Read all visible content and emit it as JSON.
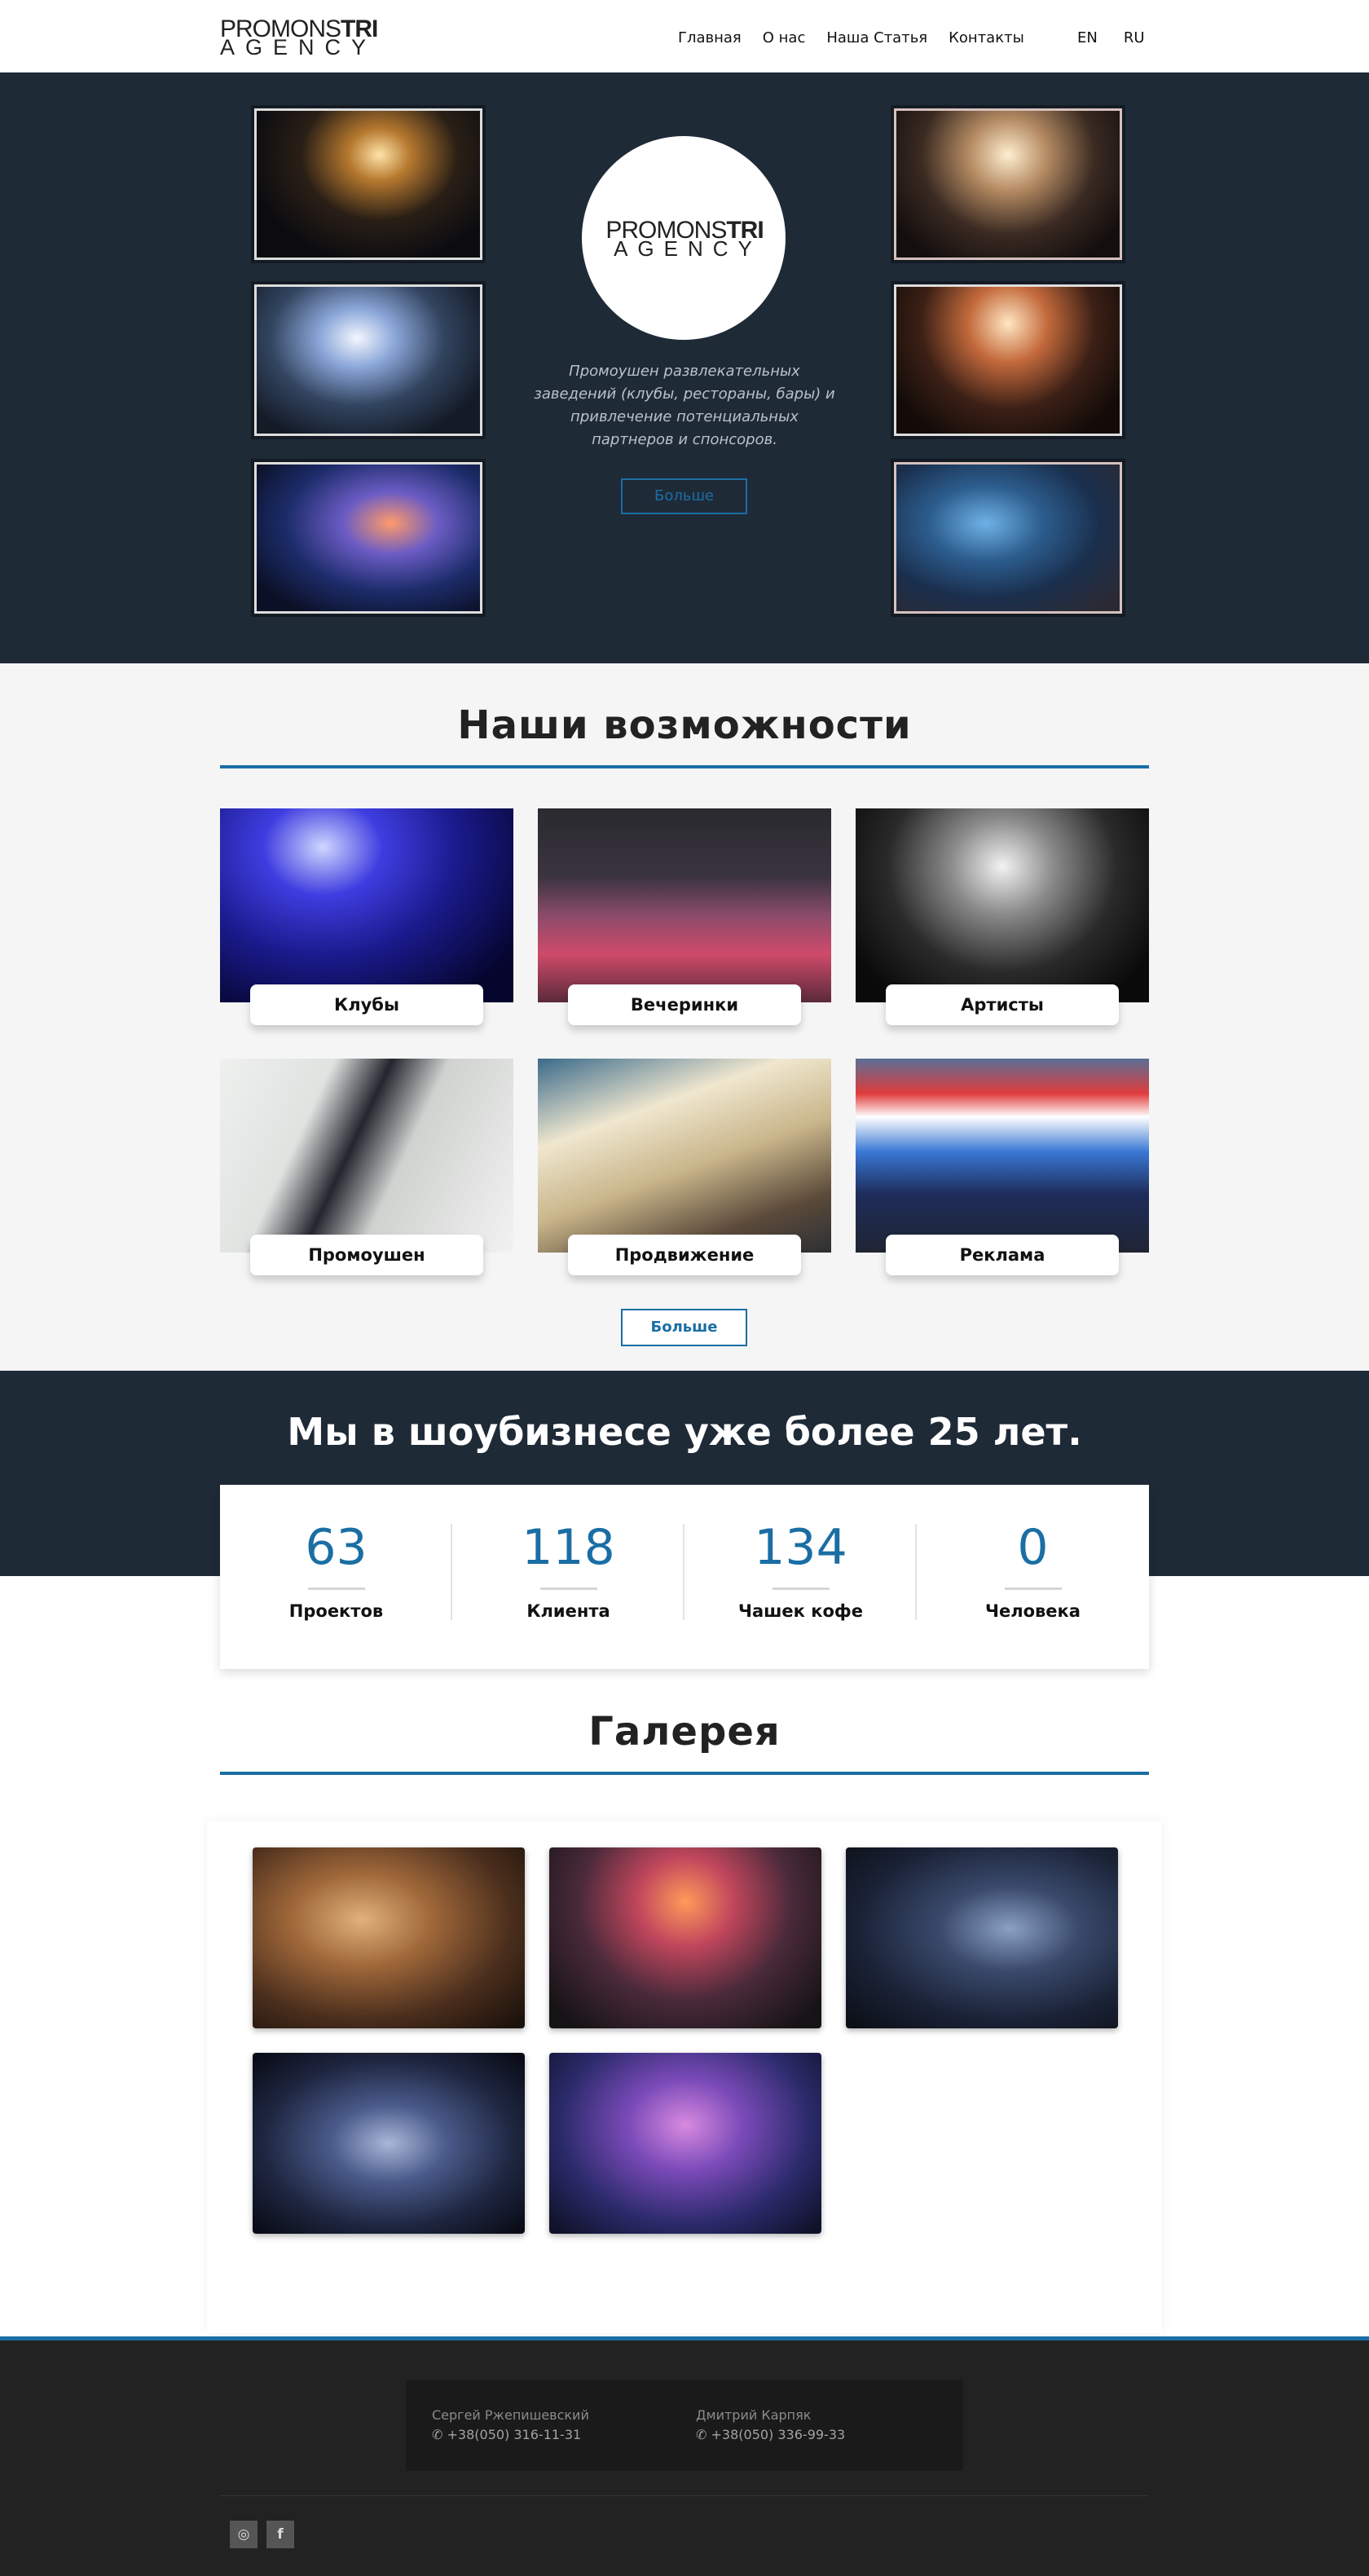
{
  "header": {
    "logo_top": "PROMONS",
    "logo_bold": "TRI",
    "logo_bottom": "AGENCY",
    "nav": [
      "Главная",
      "О нас",
      "Наша Статья",
      "Контакты"
    ],
    "langs": [
      "EN",
      "RU"
    ]
  },
  "hero": {
    "logo_top": "PROMONS",
    "logo_bold": "TRI",
    "logo_bottom": "AGENCY",
    "text": "Промоушен развлекательных заведений (клубы, рестораны, бары) и привлечение потенциальных партнеров и спонсоров.",
    "button": "Больше"
  },
  "features": {
    "title": "Наши возможности",
    "cards": [
      "Клубы",
      "Вечеринки",
      "Артисты",
      "Промоушен",
      "Продвижение",
      "Реклама"
    ],
    "button": "Больше"
  },
  "stats": {
    "title": "Мы в шоубизнесе уже более 25 лет.",
    "items": [
      {
        "num": "63",
        "label": "Проектов"
      },
      {
        "num": "118",
        "label": "Клиента"
      },
      {
        "num": "134",
        "label": "Чашек кофе"
      },
      {
        "num": "0",
        "label": "Человека"
      }
    ]
  },
  "gallery": {
    "title": "Галерея"
  },
  "footer": {
    "contacts": [
      {
        "name": "Сергей Ржепишевский",
        "phone": "+38(050) 316-11-31"
      },
      {
        "name": "Дмитрий Карпяк",
        "phone": "+38(050) 336-99-33"
      }
    ],
    "social": [
      "instagram-icon",
      "facebook-icon"
    ]
  },
  "colors": {
    "accent": "#1a6ea4",
    "dark": "#1f2a37",
    "footer": "#222222"
  }
}
